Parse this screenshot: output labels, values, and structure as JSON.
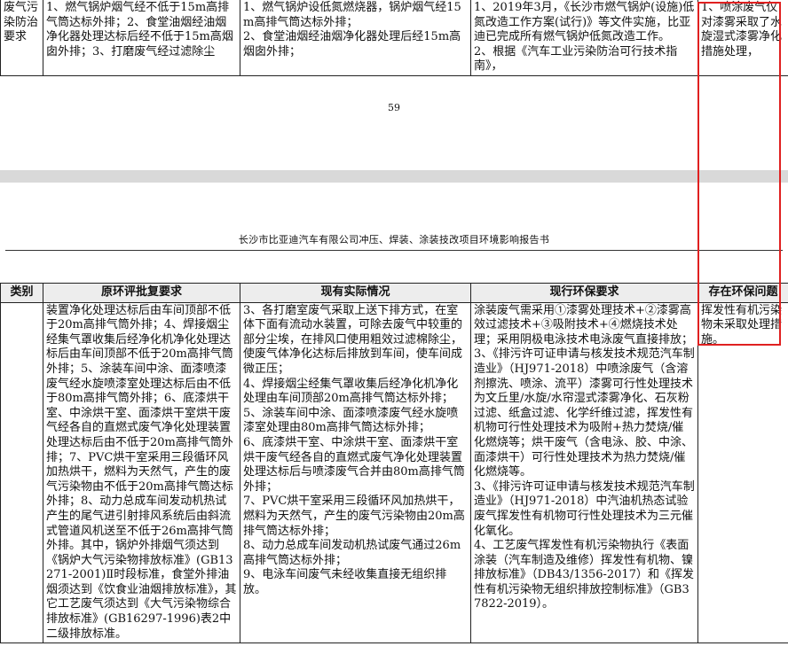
{
  "top_table": {
    "category": "废气污染防治要求",
    "original_requirement": "1、燃气锅炉烟气经不低于15m高排气筒达标外排；2、食堂油烟经油烟净化器处理达标后经不低于15m高烟囱外排；3、打磨废气经过滤除尘",
    "current_situation": "1、燃气锅炉设低氮燃烧器，锅炉烟气经15m高排气筒达标外排；\n2、食堂油烟经油烟净化器处理后经15m高烟囱外排；",
    "current_requirement": "1、2019年3月，《长沙市燃气锅炉(设施)低氮改造工作方案(试行)》等文件实施，比亚迪已完成所有燃气锅炉低氮改造工作。\n2、根据《汽车工业污染防治可行技术指南》，",
    "problem": "1、喷涂废气仅对漆雾采取了水旋湿式漆雾净化措施处理，"
  },
  "page_number": "59",
  "report_header": "长沙市比亚迪汽车有限公司冲压、焊装、涂装技改项目环境影响报告书",
  "bottom_table": {
    "headers": [
      "类别",
      "原环评批复要求",
      "现有实际情况",
      "现行环保要求",
      "存在环保问题"
    ],
    "category": "",
    "original_requirement": "装置净化处理达标后由车间顶部不低于20m高排气筒外排；4、焊接烟尘经集气罩收集后经净化机净化处理达标后由车间顶部不低于20m高排气筒外排；5、涂装车间中涂、面漆喷漆废气经水旋喷漆室处理达标后由不低于80m高排气筒外排；6、底漆烘干室、中涂烘干室、面漆烘干室烘干废气经各自的直燃式废气净化处理装置处理达标后由不低于20m高排气筒外排；7、PVC烘干室采用三段循环风加热烘干，燃料为天然气，产生的废气污染物由不低于20m高排气筒达标外排；8、动力总成车间发动机热试产生的尾气进引射排风系统后由斜流式管道风机送至不低于26m高排气筒外排。其中，锅炉外排烟气须达到《锅炉大气污染物排放标准》(GB13271-2001)Ⅱ时段标准，食堂外排油烟须达到《饮食业油烟排放标准》，其它工艺废气须达到《大气污染物综合排放标准》(GB16297-1996)表2中二级排放标准。",
    "current_situation": "3、各打磨室废气采取上送下排方式，在室体下面有流动水装置，可除去废气中较重的部分尘埃，在排风口使用粗效过滤棉除尘，使废气体净化达标后排放到车间，使车间成微正压；\n4、焊接烟尘经集气罩收集后经净化机净化处理由车间顶部20m高排气筒达标外排；\n5、涂装车间中涂、面漆喷漆废气经水旋喷漆室处理由80m高排气筒达标外排；\n6、底漆烘干室、中涂烘干室、面漆烘干室烘干废气经各自的直燃式废气净化处理装置处理达标后与喷漆废气合并由80m高排气筒外排；\n7、PVC烘干室采用三段循环风加热烘干，燃料为天然气，产生的废气污染物由20m高排气筒达标外排；\n8、动力总成车间发动机热试废气通过26m高排气筒达标外排；\n9、电泳车间废气未经收集直接无组织排放。",
    "current_requirement": "涂装废气需采用①漆雾处理技术+②漆雾高效过滤技术+③吸附技术+④燃烧技术处理；采用阴极电泳技术电泳废气直接排放；\n3、《排污许可证申请与核发技术规范汽车制造业》（HJ971-2018）中喷涂废气（含溶剂擦洗、喷涂、流平）漆雾可行性处理技术为文丘里/水旋/水帘湿式漆雾净化、石灰粉过滤、纸盒过滤、化学纤维过滤，挥发性有机物可行性处理技术为吸附+热力焚烧/催化燃烧等；烘干废气（含电泳、胶、中涂、面漆烘干）可行性处理技术为热力焚烧/催化燃烧等。\n3、《排污许可证申请与核发技术规范汽车制造业》（HJ971-2018）中汽油机热态试验废气挥发性有机物可行性处理技术为三元催化氧化。\n4、工艺废气挥发性有机污染物执行《表面涂装（汽车制造及维修）挥发性有机物、镍排放标准》（DB43/1356-2017）和《挥发性有机污染物无组织排放控制标准》（GB37822-2019）。",
    "problem": "挥发性有机污染物未采取处理措施。"
  },
  "highlight_color": "#e02020"
}
